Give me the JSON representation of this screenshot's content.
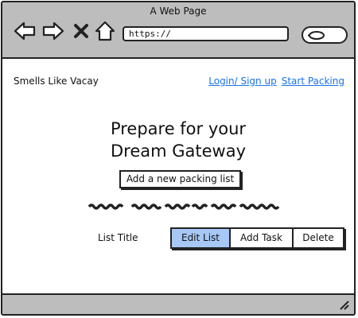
{
  "window": {
    "title": "A Web Page"
  },
  "browser": {
    "url": "https://",
    "icons": [
      "back-arrow-icon",
      "forward-arrow-icon",
      "close-x-icon",
      "home-icon",
      "search-icon"
    ]
  },
  "header": {
    "brand": "Smells Like Vacay",
    "links": [
      "Login/ Sign up",
      "Start Packing"
    ],
    "link_color": "#1a73e8"
  },
  "main": {
    "heading_line1": "Prepare for your",
    "heading_line2": "Dream Gateway",
    "add_button": "Add a new packing list",
    "list": {
      "title": "List Title",
      "actions": [
        "Edit List",
        "Add Task",
        "Delete"
      ],
      "selected_action": "Edit List",
      "selected_color": "#a7c8f5"
    }
  },
  "colors": {
    "chrome": "#bdbdbd",
    "outline": "#222222"
  }
}
